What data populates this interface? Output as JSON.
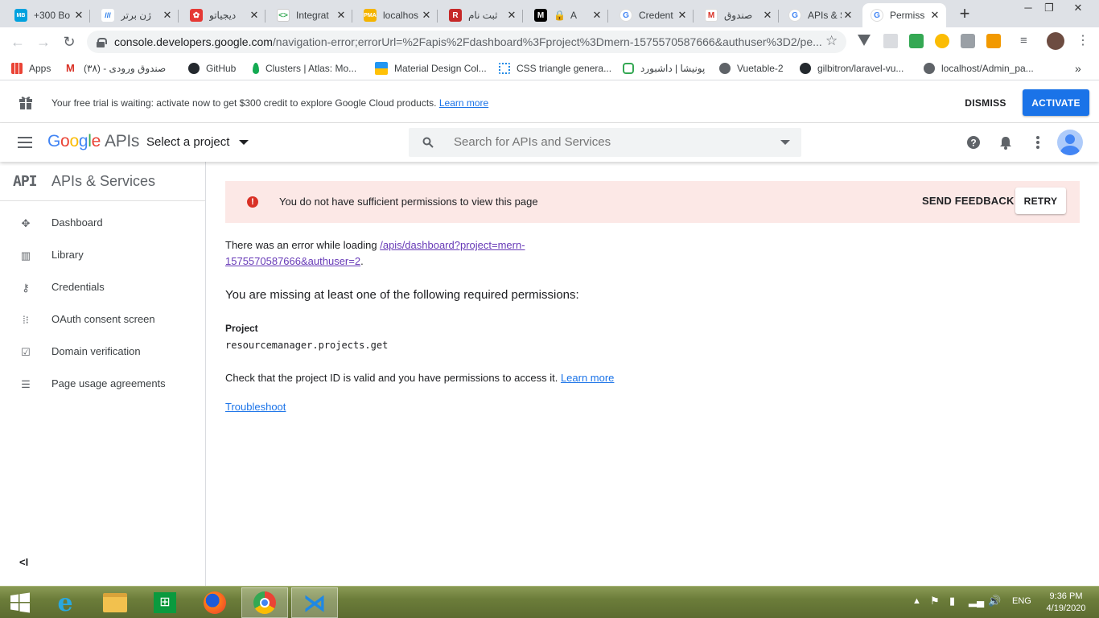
{
  "browser": {
    "tabs": [
      {
        "title": "+300 Bo",
        "icon": "medium-icon",
        "color": "#00a1de"
      },
      {
        "title": "ژن برتر",
        "icon": "mbt-icon",
        "color": "#1a73e8"
      },
      {
        "title": "دیجیاتو",
        "icon": "digiato-icon",
        "color": "#e53935"
      },
      {
        "title": "Integrat",
        "icon": "code-icon",
        "color": "#34a853"
      },
      {
        "title": "localhos",
        "icon": "phpmyadmin-icon",
        "color": "#f4b400"
      },
      {
        "title": "ثبت نام",
        "icon": "r-icon",
        "color": "#c62828"
      },
      {
        "title": "A",
        "icon": "medium-m-icon",
        "color": "#000000"
      },
      {
        "title": "Credent",
        "icon": "google-icon",
        "color": "#4285f4"
      },
      {
        "title": "صندوق",
        "icon": "gmail-icon",
        "color": "#d93025"
      },
      {
        "title": "APIs & S",
        "icon": "google-icon",
        "color": "#4285f4"
      },
      {
        "title": "Permiss",
        "icon": "google-icon",
        "color": "#4285f4"
      }
    ],
    "url_domain": "console.developers.google.com",
    "url_path": "/navigation-error;errorUrl=%2Fapis%2Fdashboard%3Fproject%3Dmern-1575570587666&authuser%3D2/pe...",
    "bookmarks": [
      {
        "label": "Apps",
        "icon": "apps-grid-icon"
      },
      {
        "label": "صندوق ورودی - (۳۸)",
        "icon": "gmail-icon"
      },
      {
        "label": "GitHub",
        "icon": "github-icon"
      },
      {
        "label": "Clusters | Atlas: Mo...",
        "icon": "mongodb-leaf-icon"
      },
      {
        "label": "Material Design Col...",
        "icon": "material-icon"
      },
      {
        "label": "CSS triangle genera...",
        "icon": "css-icon"
      },
      {
        "label": "پونیشا | داشبورد",
        "icon": "ponisha-icon"
      },
      {
        "label": "Vuetable-2",
        "icon": "globe-icon"
      },
      {
        "label": "gilbitron/laravel-vu...",
        "icon": "github-icon"
      },
      {
        "label": "localhost/Admin_pa...",
        "icon": "globe-icon"
      }
    ],
    "more_bookmarks": "»"
  },
  "banner": {
    "message": "Your free trial is waiting: activate now to get $300 credit to explore Google Cloud products.",
    "learn_more": "Learn more",
    "dismiss": "DISMISS",
    "activate": "ACTIVATE"
  },
  "appbar": {
    "logo_google": "Google",
    "logo_apis": "APIs",
    "project_selector": "Select a project",
    "search_placeholder": "Search for APIs and Services"
  },
  "sidebar": {
    "logo": "API",
    "title": "APIs & Services",
    "items": [
      {
        "label": "Dashboard",
        "icon": "dashboard-icon"
      },
      {
        "label": "Library",
        "icon": "library-icon"
      },
      {
        "label": "Credentials",
        "icon": "key-icon"
      },
      {
        "label": "OAuth consent screen",
        "icon": "oauth-icon"
      },
      {
        "label": "Domain verification",
        "icon": "checkbox-icon"
      },
      {
        "label": "Page usage agreements",
        "icon": "settings-list-icon"
      }
    ],
    "collapse": "<I"
  },
  "error": {
    "message": "You do not have sufficient permissions to view this page",
    "send_feedback": "SEND FEEDBACK",
    "retry": "RETRY",
    "loading_text": "There was an error while loading",
    "loading_link_1": "/apis/dashboard?project=mern-",
    "loading_link_2": "1575570587666&authuser=2",
    "loading_suffix": ".",
    "missing_heading": "You are missing at least one of the following required permissions:",
    "project_label": "Project",
    "permission": "resourcemanager.projects.get",
    "check_text": "Check that the project ID is valid and you have permissions to access it.",
    "check_link": "Learn more",
    "troubleshoot": "Troubleshoot"
  },
  "taskbar": {
    "language": "ENG",
    "time": "9:36 PM",
    "date": "4/19/2020"
  },
  "colors": {
    "accent_blue": "#1a73e8",
    "error_bg": "#fce8e6",
    "error_icon": "#d93025",
    "link_purple": "#673ab7"
  }
}
